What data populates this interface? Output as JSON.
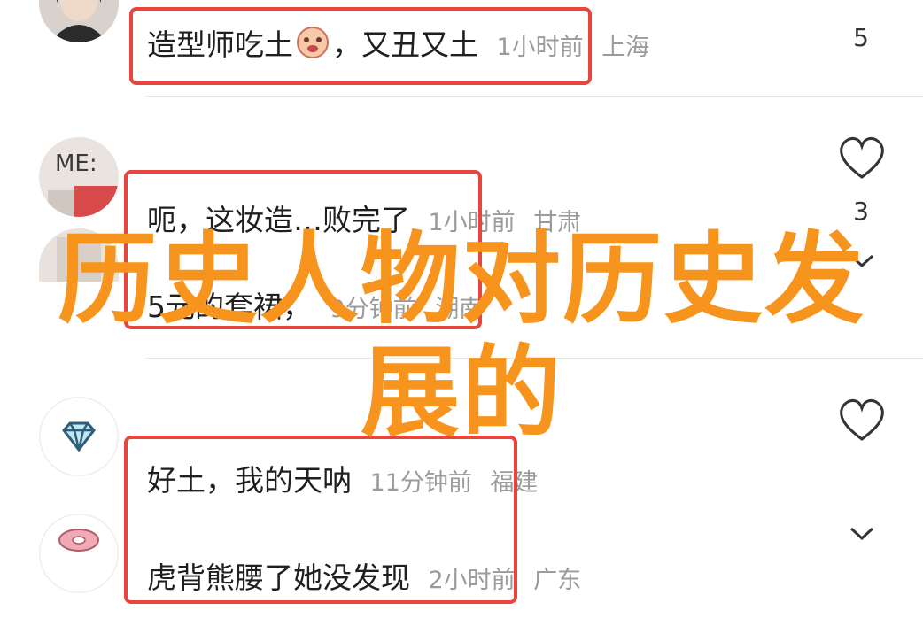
{
  "comments": [
    {
      "text": "造型师吃土",
      "emoji_suffix": "，又丑又土",
      "time": "1小时前",
      "location": "上海",
      "likes": "5"
    },
    {
      "text": "呃，这妆造…败完了",
      "time": "1小时前",
      "location": "甘肃",
      "likes": "3"
    },
    {
      "text": "5元的套裙，",
      "time": "9分钟前",
      "location": "湖南",
      "likes": ""
    },
    {
      "text": "好土，我的天呐",
      "time": "11分钟前",
      "location": "福建",
      "likes": ""
    },
    {
      "text": "虎背熊腰了她没发现",
      "time": "2小时前",
      "location": "广东",
      "likes": ""
    }
  ],
  "avatar_text": "ME:",
  "overlay": {
    "line1": "历史人物对历史发",
    "line2": "展的"
  },
  "colors": {
    "accent_red": "#e8453c",
    "overlay_orange": "#f7941d",
    "meta_gray": "#9b9b9b"
  },
  "icons": [
    "heart-icon",
    "chevron-down-icon",
    "diamond-icon",
    "donut-icon",
    "pleading-face-emoji"
  ]
}
